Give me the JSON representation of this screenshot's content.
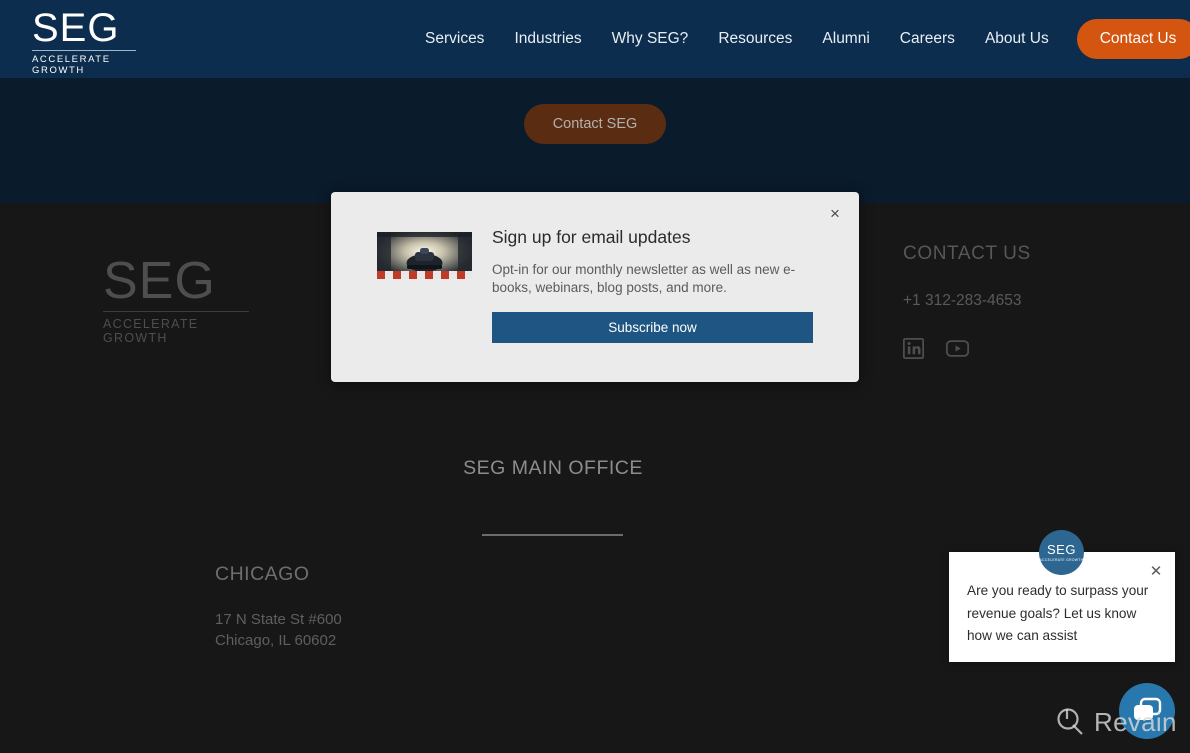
{
  "header": {
    "logo": {
      "name": "SEG",
      "tagline": "ACCELERATE GROWTH"
    },
    "nav": [
      {
        "label": "Services"
      },
      {
        "label": "Industries"
      },
      {
        "label": "Why SEG?"
      },
      {
        "label": "Resources"
      },
      {
        "label": "Alumni"
      },
      {
        "label": "Careers"
      },
      {
        "label": "About Us"
      }
    ],
    "cta_label": "Contact Us",
    "cta_color": "#d4550f",
    "background_color": "#0c2d4d"
  },
  "page": {
    "contact_seg_button": "Contact SEG",
    "navy_band_color": "#0a1b2c",
    "footer_background": "#171717"
  },
  "footer": {
    "logo": {
      "name": "SEG",
      "tagline": "ACCELERATE GROWTH"
    },
    "office_title": "SEG MAIN OFFICE",
    "city": "CHICAGO",
    "address_line1": "17 N State St #600",
    "address_line2": "Chicago, IL 60602",
    "contact": {
      "heading": "CONTACT US",
      "phone": "+1 312-283-4653",
      "socials": [
        {
          "name": "linkedin-icon"
        },
        {
          "name": "youtube-icon"
        }
      ]
    }
  },
  "modal": {
    "title": "Sign up for email updates",
    "description": "Opt-in for our monthly newsletter as well as new e-books, webinars, blog posts, and more.",
    "subscribe_label": "Subscribe now",
    "subscribe_color": "#1e5582",
    "close_label": "×",
    "thumbnail": "race-car-thumbnail",
    "background_color": "#ebebeb"
  },
  "chat": {
    "message": "Are you ready to surpass your revenue goals? Let us know how we can assist",
    "close_label": "✕",
    "avatar_label": "SEG",
    "avatar_tagline": "ACCELERATE GROWTH",
    "avatar_color": "#2d6690",
    "launcher_color": "#2878ad",
    "launcher_icon": "chat-bubble-icon"
  },
  "watermark": {
    "text": "Revain",
    "icon": "revain-logo-icon"
  }
}
